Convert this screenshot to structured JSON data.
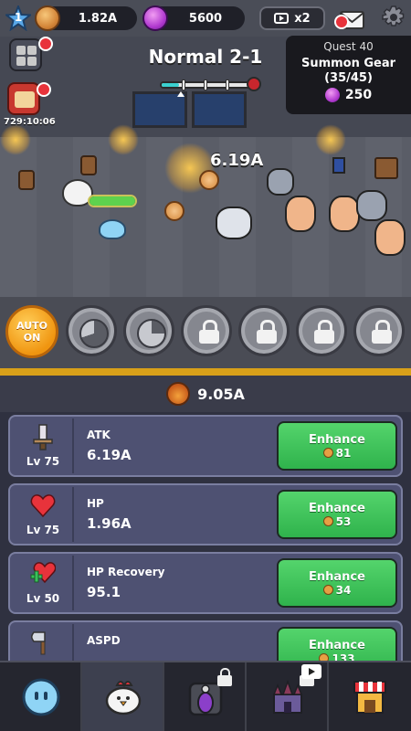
{
  "player": {
    "level": "1"
  },
  "currency": {
    "coins": "1.82A",
    "gems": "5600"
  },
  "ad_boost": {
    "label": "x2"
  },
  "stage": {
    "title": "Normal 2-1"
  },
  "quest": {
    "title": "Quest 40",
    "name": "Summon Gear",
    "progress": "(35/45)",
    "reward": "250"
  },
  "side": {
    "timer": "729:10:06"
  },
  "combat": {
    "damage_text": "6.19A"
  },
  "auto_button": {
    "line1": "AUTO",
    "line2": "ON"
  },
  "power": {
    "value": "9.05A"
  },
  "stats": [
    {
      "name": "ATK",
      "level": "Lv 75",
      "value": "6.19A",
      "button": "Enhance",
      "cost": "81"
    },
    {
      "name": "HP",
      "level": "Lv 75",
      "value": "1.96A",
      "button": "Enhance",
      "cost": "53"
    },
    {
      "name": "HP Recovery",
      "level": "Lv 50",
      "value": "95.1",
      "button": "Enhance",
      "cost": "34"
    },
    {
      "name": "ASPD",
      "level": "",
      "value": "",
      "button": "Enhance",
      "cost": "133"
    }
  ],
  "colors": {
    "accent_orange": "#f09510",
    "enhance_green": "#2fb34c",
    "card_bg": "#4e5172",
    "badge_red": "#e8333b"
  },
  "icons": {
    "level": "star-icon",
    "coin": "coin-icon",
    "gem": "gem-icon",
    "ad": "video-ad-icon",
    "mail": "mail-icon",
    "settings": "gear-icon"
  }
}
